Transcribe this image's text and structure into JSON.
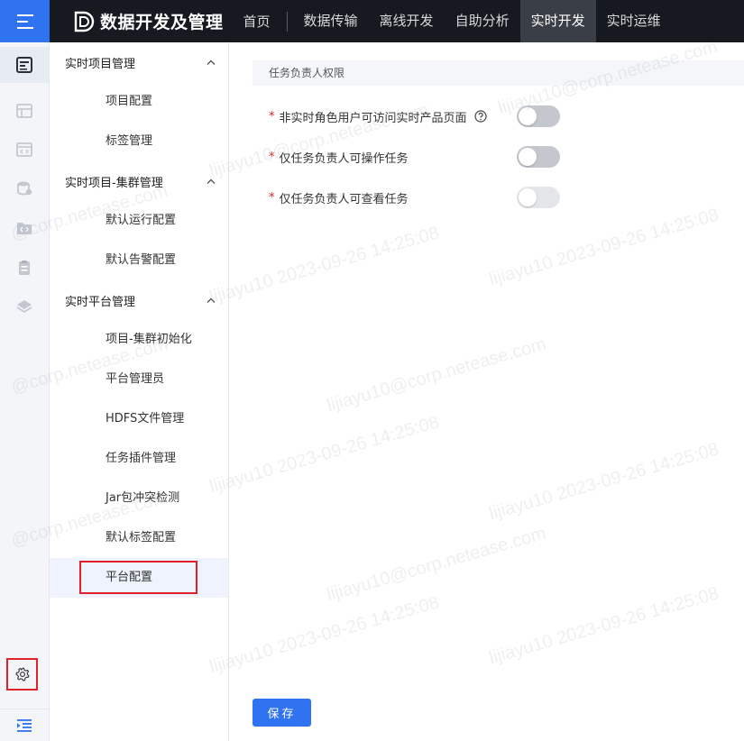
{
  "app": {
    "title": "数据开发及管理"
  },
  "nav": {
    "items": [
      {
        "label": "首页",
        "active": false
      },
      {
        "label": "数据传输",
        "active": false
      },
      {
        "label": "离线开发",
        "active": false
      },
      {
        "label": "自助分析",
        "active": false
      },
      {
        "label": "实时开发",
        "active": true
      },
      {
        "label": "实时运维",
        "active": false
      }
    ]
  },
  "rail": {
    "icons": [
      "dashboard-icon",
      "table-icon",
      "code-window-icon",
      "database-icon",
      "folder-code-icon",
      "clipboard-icon",
      "layers-icon"
    ],
    "settings_icon": "gear-icon",
    "collapse_icon": "indent-icon"
  },
  "submenu": {
    "groups": [
      {
        "title": "实时项目管理",
        "items": [
          "项目配置",
          "标签管理"
        ]
      },
      {
        "title": "实时项目-集群管理",
        "items": [
          "默认运行配置",
          "默认告警配置"
        ]
      },
      {
        "title": "实时平台管理",
        "items": [
          "项目-集群初始化",
          "平台管理员",
          "HDFS文件管理",
          "任务插件管理",
          "Jar包冲突检测",
          "默认标签配置",
          "平台配置"
        ]
      }
    ],
    "selected": "平台配置"
  },
  "main": {
    "section_title": "任务负责人权限",
    "settings": [
      {
        "label": "非实时角色用户可访问实时产品页面",
        "required": true,
        "help": true,
        "enabled": false,
        "disabled": false
      },
      {
        "label": "仅任务负责人可操作任务",
        "required": true,
        "help": false,
        "enabled": false,
        "disabled": false
      },
      {
        "label": "仅任务负责人可查看任务",
        "required": true,
        "help": false,
        "enabled": false,
        "disabled": true
      }
    ],
    "required_mark": "*",
    "save_label": "保存"
  },
  "watermark": {
    "user_text": "lijiayu10@corp.netease.com",
    "time_text": "lijiayu10 2023-09-26 14:25:08",
    "domain_text": "@corp.netease.com",
    "color": "#a0a5af"
  },
  "colors": {
    "accent": "#2f73f0",
    "topbar": "#16191f",
    "highlight": "#e0202a"
  }
}
